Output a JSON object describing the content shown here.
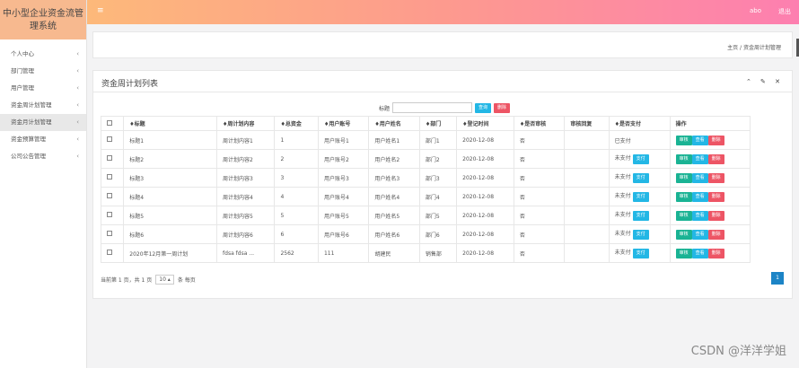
{
  "app": {
    "title": "中小型企业资金流管理系统"
  },
  "sidebar": {
    "items": [
      {
        "label": "个人中心"
      },
      {
        "label": "部门管理"
      },
      {
        "label": "用户管理"
      },
      {
        "label": "资金周计划管理"
      },
      {
        "label": "资金月计划管理"
      },
      {
        "label": "资金预算管理"
      },
      {
        "label": "公司公告管理"
      }
    ],
    "active_index": 4
  },
  "topbar": {
    "menu_icon": "≡",
    "user": "abo",
    "logout": "退出"
  },
  "breadcrumb": {
    "home": "主页",
    "sep": "/",
    "current": "资金周计划管理"
  },
  "panel": {
    "title": "资金周计划列表",
    "tools": "⌃ ✎ ✕"
  },
  "search": {
    "label": "标题",
    "value": "",
    "search_btn": "查询",
    "delete_btn": "删除"
  },
  "table": {
    "headers": [
      "",
      "♦标题",
      "♦周计划内容",
      "♦总资金",
      "♦用户账号",
      "♦用户姓名",
      "♦部门",
      "♦登记时间",
      "♦是否审核",
      "审核回复",
      "♦是否支付",
      "操作"
    ],
    "rows": [
      [
        "",
        "标题1",
        "周计划内容1",
        "1",
        "用户账号1",
        "用户姓名1",
        "部门1",
        "2020-12-08",
        "否",
        "",
        "已支付"
      ],
      [
        "",
        "标题2",
        "周计划内容2",
        "2",
        "用户账号2",
        "用户姓名2",
        "部门2",
        "2020-12-08",
        "否",
        "",
        "未支付"
      ],
      [
        "",
        "标题3",
        "周计划内容3",
        "3",
        "用户账号3",
        "用户姓名3",
        "部门3",
        "2020-12-08",
        "否",
        "",
        "未支付"
      ],
      [
        "",
        "标题4",
        "周计划内容4",
        "4",
        "用户账号4",
        "用户姓名4",
        "部门4",
        "2020-12-08",
        "否",
        "",
        "未支付"
      ],
      [
        "",
        "标题5",
        "周计划内容5",
        "5",
        "用户账号5",
        "用户姓名5",
        "部门5",
        "2020-12-08",
        "否",
        "",
        "未支付"
      ],
      [
        "",
        "标题6",
        "周计划内容6",
        "6",
        "用户账号6",
        "用户姓名6",
        "部门6",
        "2020-12-08",
        "否",
        "",
        "未支付"
      ],
      [
        "",
        "2020年12月第一周计划",
        "fdsa fdsa ...",
        "2562",
        "111",
        "胡建民",
        "销售部",
        "2020-12-08",
        "否",
        "",
        "未支付"
      ]
    ],
    "pay_btn": "支付",
    "actions": [
      "审核",
      "查看",
      "删除"
    ]
  },
  "footer": {
    "prefix": "当前第 1 页，共 1 页",
    "page_size": "10 ▴",
    "suffix": "条 每页",
    "page": "1"
  },
  "watermark": "CSDN @洋洋学姐"
}
